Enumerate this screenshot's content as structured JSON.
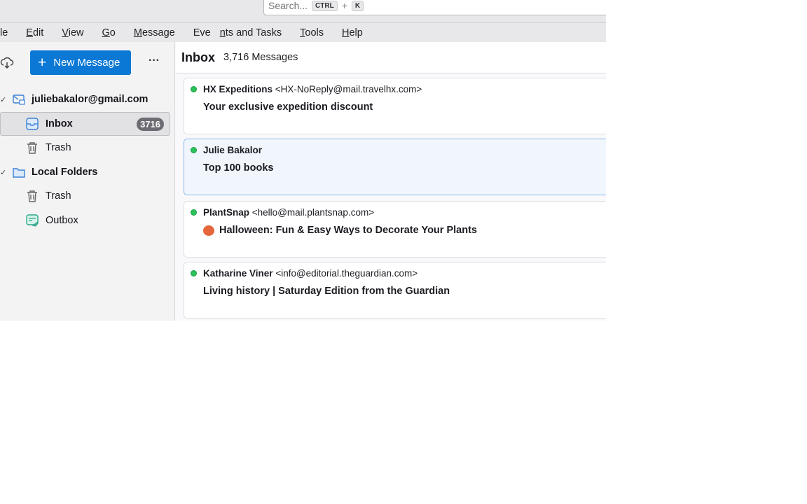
{
  "search": {
    "placeholder": "Search...",
    "key1": "CTRL",
    "plus": "+",
    "key2": "K"
  },
  "menu": [
    {
      "pre": "",
      "u": "",
      "post": "le"
    },
    {
      "pre": "",
      "u": "E",
      "post": "dit"
    },
    {
      "pre": "",
      "u": "V",
      "post": "iew"
    },
    {
      "pre": "",
      "u": "G",
      "post": "o"
    },
    {
      "pre": "",
      "u": "M",
      "post": "essage"
    },
    {
      "pre": "Eve",
      "u": "n",
      "post": "ts and Tasks"
    },
    {
      "pre": "",
      "u": "T",
      "post": "ools"
    },
    {
      "pre": "",
      "u": "H",
      "post": "elp"
    }
  ],
  "toolbar": {
    "new_message": "New Message",
    "plus": "+",
    "more": "···"
  },
  "folders": {
    "account": "juliebakalor@gmail.com",
    "inbox": "Inbox",
    "inbox_count": "3716",
    "trash1": "Trash",
    "local": "Local Folders",
    "trash2": "Trash",
    "outbox": "Outbox"
  },
  "header": {
    "title": "Inbox",
    "count": "3,716 Messages"
  },
  "messages": [
    {
      "sender": "HX Expeditions",
      "address": "<HX-NoReply@mail.travelhx.com>",
      "subject": "Your exclusive expedition discount"
    },
    {
      "sender": "Julie Bakalor",
      "address": "",
      "subject": "Top 100 books"
    },
    {
      "sender": "PlantSnap",
      "address": "<hello@mail.plantsnap.com>",
      "subject": "Halloween: Fun & Easy Ways to Decorate Your Plants"
    },
    {
      "sender": "Katharine Viner",
      "address": "<info@editorial.theguardian.com>",
      "subject": "Living history | Saturday Edition from the Guardian"
    }
  ],
  "colors": {
    "accent": "#0a78d4",
    "unread_dot": "#2ac35a"
  }
}
